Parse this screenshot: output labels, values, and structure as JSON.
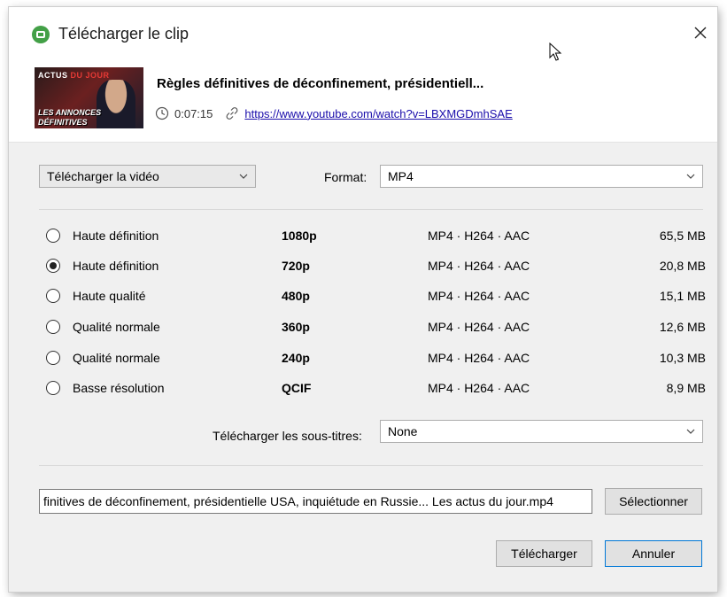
{
  "window": {
    "title": "Télécharger le clip"
  },
  "video": {
    "thumbnail": {
      "banner_a": "ACTUS",
      "banner_b": "DU JOUR",
      "tag_a": "LES ANNONCES",
      "tag_b": "DÉFINITIVES"
    },
    "title": "Règles définitives de déconfinement, présidentiell...",
    "duration": "0:07:15",
    "url": "https://www.youtube.com/watch?v=LBXMGDmhSAE"
  },
  "options": {
    "mode": "Télécharger la vidéo",
    "format_label": "Format:",
    "format": "MP4",
    "subtitles_label": "Télécharger les sous-titres:",
    "subtitles": "None"
  },
  "qualities": [
    {
      "label": "Haute définition",
      "res": "1080p",
      "codec": "MP4 · H264 · AAC",
      "size": "65,5 MB",
      "selected": false
    },
    {
      "label": "Haute définition",
      "res": "720p",
      "codec": "MP4 · H264 · AAC",
      "size": "20,8 MB",
      "selected": true
    },
    {
      "label": "Haute qualité",
      "res": "480p",
      "codec": "MP4 · H264 · AAC",
      "size": "15,1 MB",
      "selected": false
    },
    {
      "label": "Qualité normale",
      "res": "360p",
      "codec": "MP4 · H264 · AAC",
      "size": "12,6 MB",
      "selected": false
    },
    {
      "label": "Qualité normale",
      "res": "240p",
      "codec": "MP4 · H264 · AAC",
      "size": "10,3 MB",
      "selected": false
    },
    {
      "label": "Basse résolution",
      "res": "QCIF",
      "codec": "MP4 · H264 · AAC",
      "size": "8,9 MB",
      "selected": false
    }
  ],
  "output": {
    "path": "finitives de déconfinement, présidentielle USA, inquiétude en Russie... Les actus du jour.mp4",
    "select_label": "Sélectionner"
  },
  "buttons": {
    "download": "Télécharger",
    "cancel": "Annuler"
  },
  "colors": {
    "accent": "#0078d7",
    "link": "#1a0dab",
    "app_icon": "#43a047"
  }
}
